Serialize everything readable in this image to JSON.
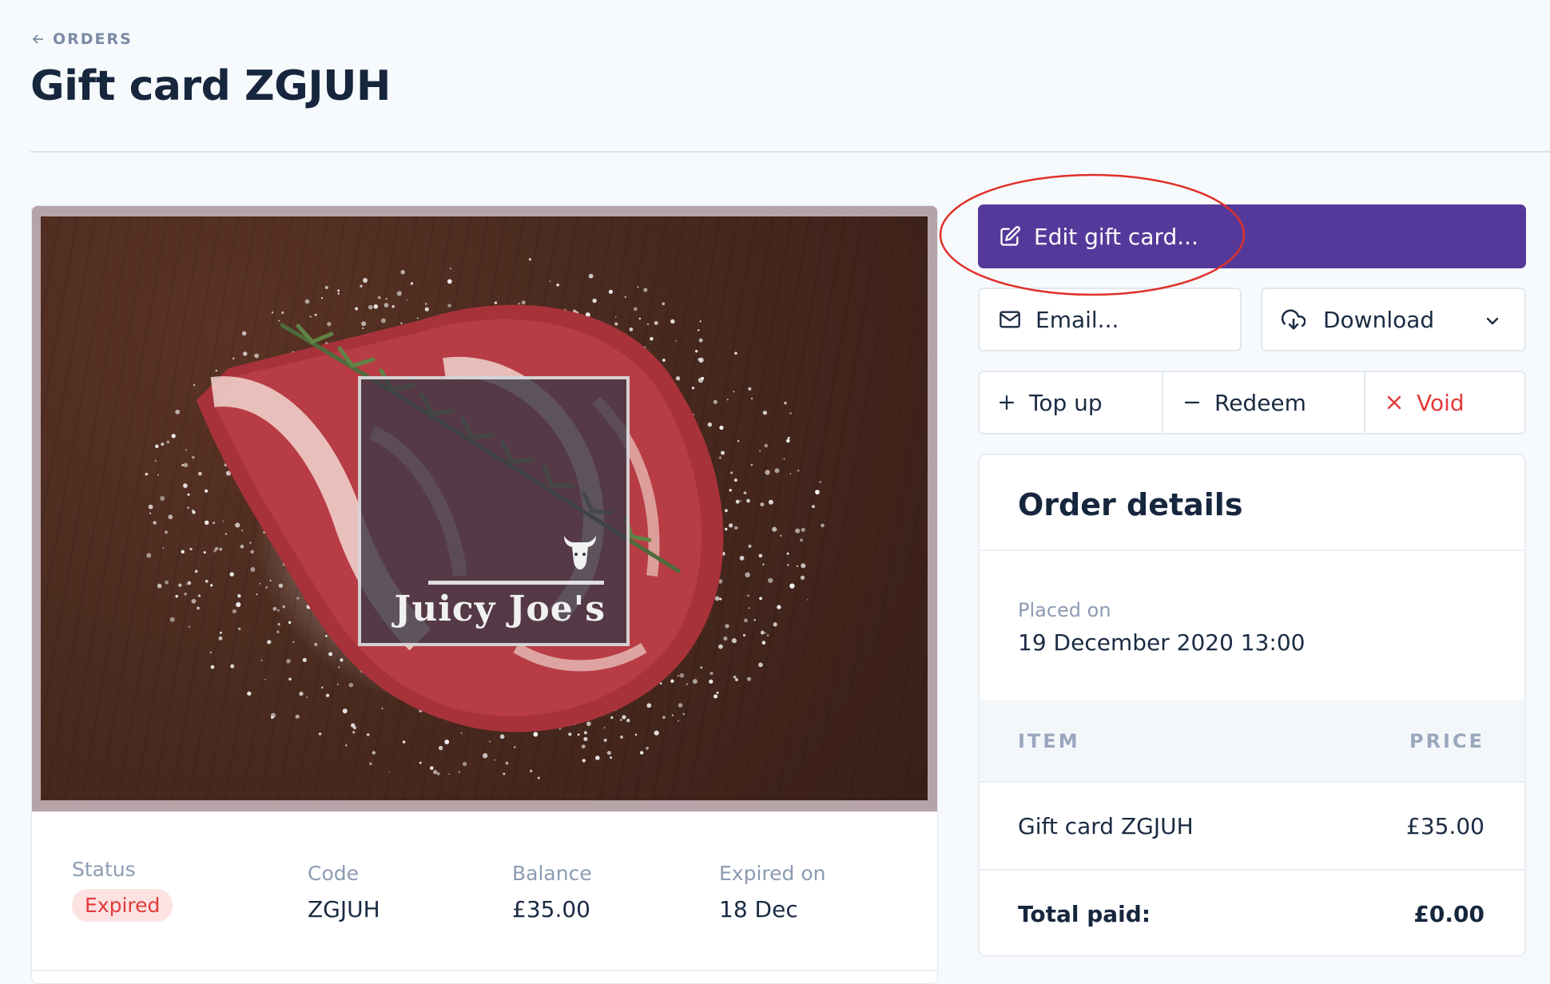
{
  "breadcrumb": {
    "label": "ORDERS",
    "icon": "arrow-left-icon"
  },
  "page": {
    "title": "Gift card ZGJUH"
  },
  "gift_card_image": {
    "logo_text": "Juicy Joe's",
    "icons": [
      "bull-head-icon"
    ]
  },
  "info": {
    "status_label": "Status",
    "status_value": "Expired",
    "code_label": "Code",
    "code_value": "ZGJUH",
    "balance_label": "Balance",
    "balance_value": "£35.00",
    "expired_label": "Expired on",
    "expired_value": "18 Dec"
  },
  "actions": {
    "edit_label": "Edit gift card...",
    "email_label": "Email...",
    "download_label": "Download",
    "topup_label": "Top up",
    "redeem_label": "Redeem",
    "void_label": "Void"
  },
  "order": {
    "title": "Order details",
    "placed_label": "Placed on",
    "placed_value": "19 December 2020 13:00",
    "col_item": "ITEM",
    "col_price": "PRICE",
    "items": [
      {
        "name": "Gift card ZGJUH",
        "price": "£35.00"
      }
    ],
    "total_label": "Total paid:",
    "total_value": "£0.00"
  },
  "colors": {
    "primary": "#55399a",
    "danger": "#e23a3a",
    "annotation": "#e0302a"
  }
}
